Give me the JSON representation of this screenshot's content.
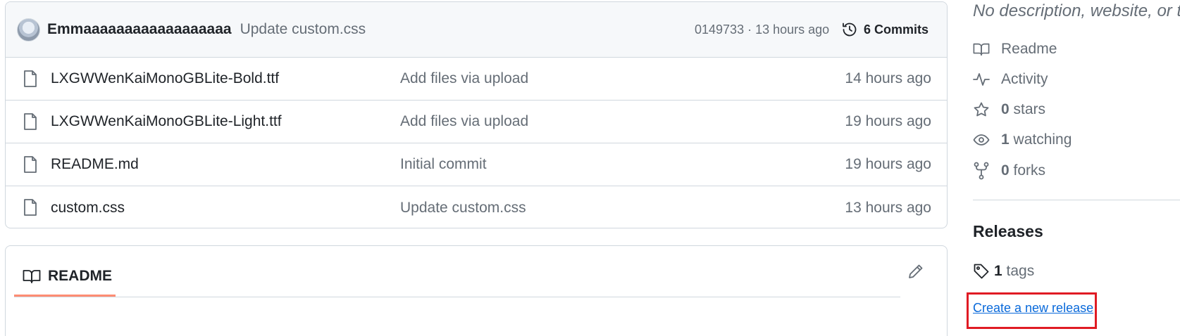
{
  "commit_bar": {
    "author": "Emmaaaaaaaaaaaaaaaaaa",
    "message": "Update custom.css",
    "meta": "0149733 · 13 hours ago",
    "commits_label": "6 Commits"
  },
  "files": [
    {
      "name": "LXGWWenKaiMonoGBLite-Bold.ttf",
      "commit": "Add files via upload",
      "time": "14 hours ago"
    },
    {
      "name": "LXGWWenKaiMonoGBLite-Light.ttf",
      "commit": "Add files via upload",
      "time": "19 hours ago"
    },
    {
      "name": "README.md",
      "commit": "Initial commit",
      "time": "19 hours ago"
    },
    {
      "name": "custom.css",
      "commit": "Update custom.css",
      "time": "13 hours ago"
    }
  ],
  "readme": {
    "tab_label": "README"
  },
  "sidebar": {
    "description": "No description, website, or to",
    "readme_label": "Readme",
    "activity_label": "Activity",
    "stars_count": "0",
    "stars_label": "stars",
    "watching_count": "1",
    "watching_label": "watching",
    "forks_count": "0",
    "forks_label": "forks",
    "releases_title": "Releases",
    "tags_count": "1",
    "tags_label": "tags",
    "create_release_label": "Create a new release"
  },
  "colors": {
    "link": "#0969da",
    "highlight": "#e01b24",
    "tab_underline": "#fd8c73"
  }
}
